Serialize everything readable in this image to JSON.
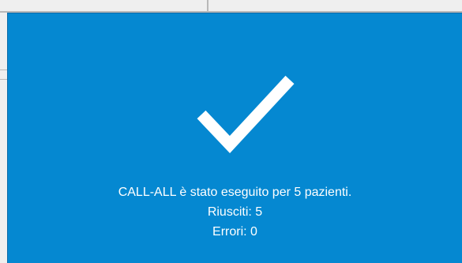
{
  "dialog": {
    "status": "success",
    "icon": "checkmark-icon",
    "accent_color": "#0588d1",
    "text_color": "#ffffff",
    "message": "CALL-ALL è stato eseguito per 5 pazienti.",
    "success_line": "Riusciti: 5",
    "error_line": "Errori: 0"
  }
}
